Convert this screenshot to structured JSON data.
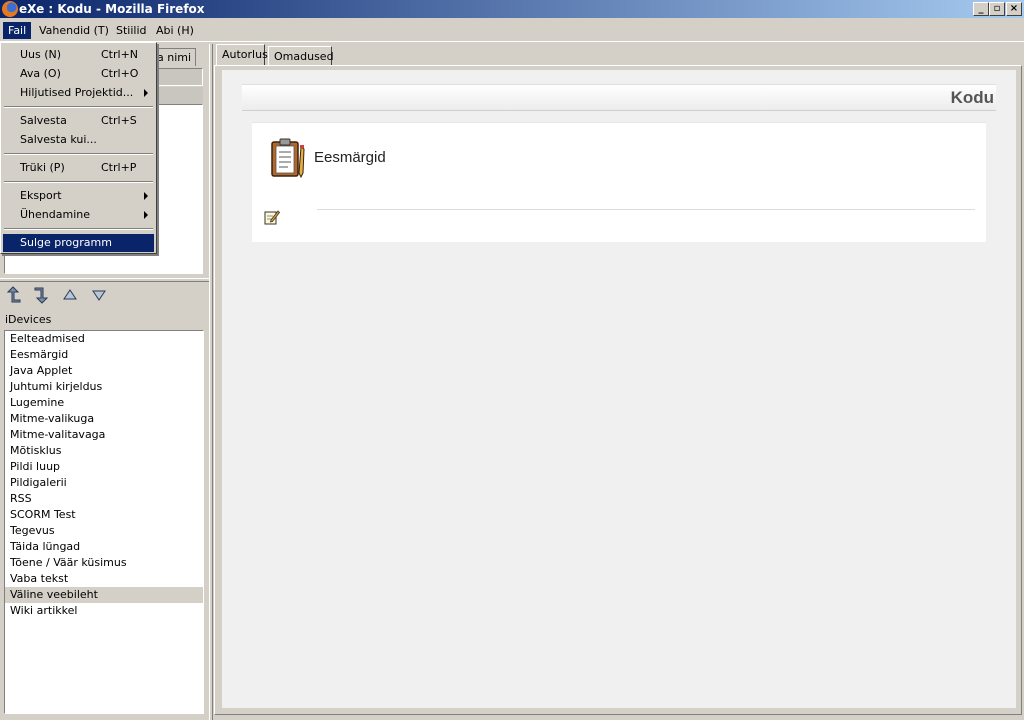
{
  "window": {
    "title": "eXe : Kodu - Mozilla Firefox"
  },
  "menubar": {
    "items": [
      "Fail",
      "Vahendid (T)",
      "Stiilid",
      "Abi (H)"
    ]
  },
  "file_menu": {
    "items": [
      {
        "label": "Uus (N)",
        "shortcut": "Ctrl+N"
      },
      {
        "label": "Ava (O)",
        "shortcut": "Ctrl+O"
      },
      {
        "label": "Hiljutised Projektid...",
        "shortcut": ""
      },
      {
        "label": "Salvesta",
        "shortcut": "Ctrl+S"
      },
      {
        "label": "Salvesta kui...",
        "shortcut": ""
      },
      {
        "label": "Trüki (P)",
        "shortcut": "Ctrl+P"
      },
      {
        "label": "Eksport",
        "shortcut": ""
      },
      {
        "label": "Ühendamine",
        "shortcut": ""
      },
      {
        "label": "Sulge programm",
        "shortcut": ""
      }
    ]
  },
  "outline": {
    "tab_label": "a nimi"
  },
  "idevices": {
    "label": "iDevices",
    "items": [
      "Eelteadmised",
      "Eesmärgid",
      "Java Applet",
      "Juhtumi kirjeldus",
      "Lugemine",
      "Mitme-valikuga",
      "Mitme-valitavaga",
      "Mõtisklus",
      "Pildi luup",
      "Pildigalerii",
      "RSS",
      "SCORM Test",
      "Tegevus",
      "Täida lüngad",
      "Tõene / Väär küsimus",
      "Vaba tekst",
      "Väline veebileht",
      "Wiki artikkel"
    ],
    "selected": "Väline veebileht"
  },
  "tabs": [
    "Autorlus",
    "Omadused"
  ],
  "document": {
    "title": "Kodu",
    "idevice_title": "Eesmärgid"
  }
}
